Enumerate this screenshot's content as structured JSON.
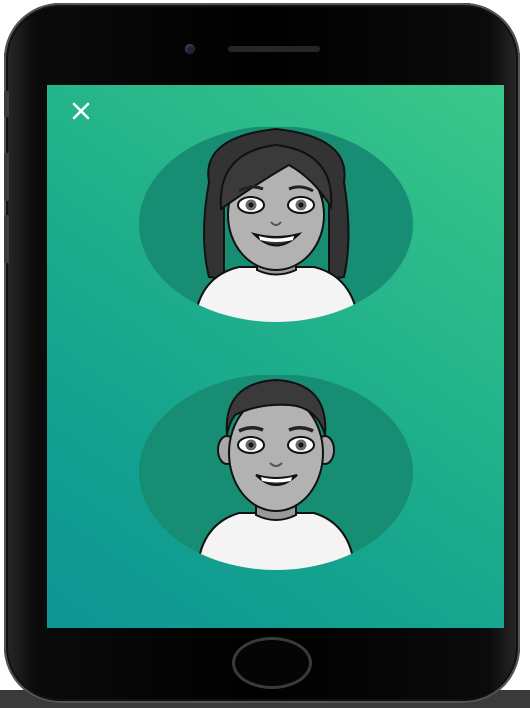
{
  "screen": {
    "title": "",
    "close_icon": "close-icon",
    "avatars": [
      {
        "name": "female-avatar",
        "icon": "avatar-female-icon"
      },
      {
        "name": "male-avatar",
        "icon": "avatar-male-icon"
      }
    ]
  },
  "device": {
    "home_button": "home-button",
    "camera": "front-camera",
    "speaker": "earpiece-speaker"
  },
  "colors": {
    "gradient_top": "#3bc88a",
    "gradient_bottom": "#0e9595",
    "avatar_circle": "#178d73",
    "phone_body": "#000000"
  }
}
